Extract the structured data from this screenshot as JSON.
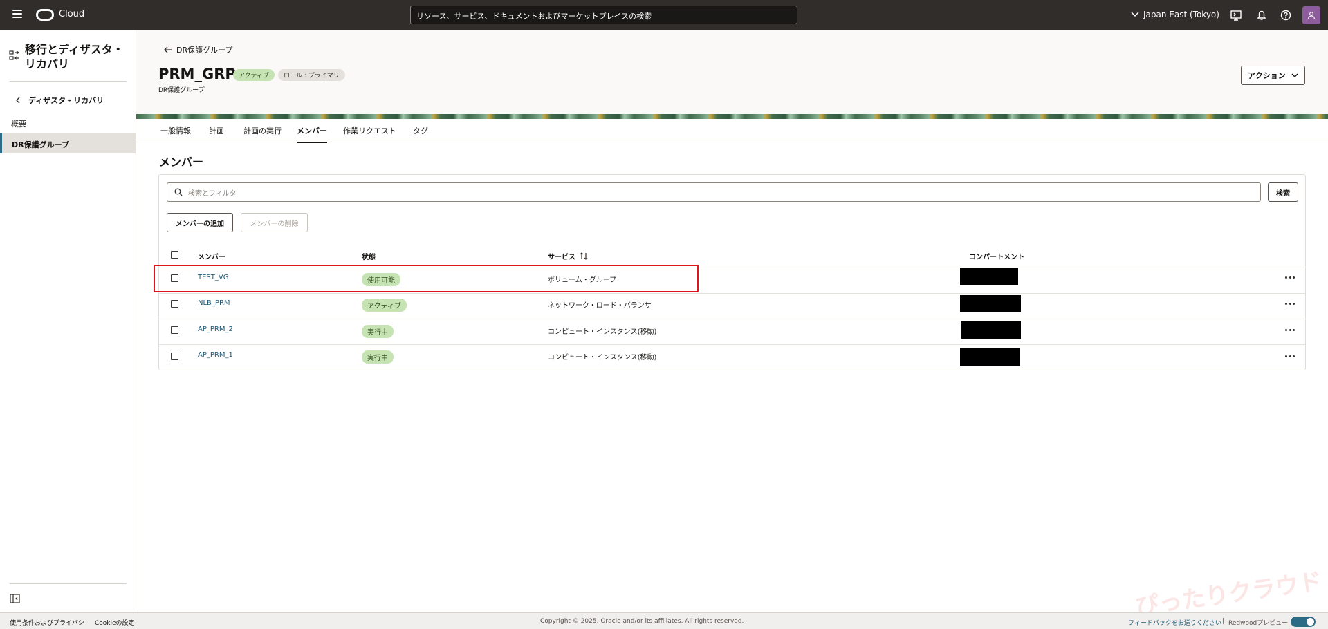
{
  "topbar": {
    "brand": "Cloud",
    "search_placeholder": "リソース、サービス、ドキュメントおよびマーケットプレイスの検索",
    "region": "Japan East (Tokyo)"
  },
  "sidenav": {
    "title": "移行とディザスタ・リカバリ",
    "back_label": "ディザスタ・リカバリ",
    "items": [
      {
        "label": "概要"
      },
      {
        "label": "DR保護グループ"
      }
    ]
  },
  "header": {
    "back_label": "DR保護グループ",
    "title": "PRM_GRP",
    "badge_status": "アクティブ",
    "badge_role": "ロール : プライマリ",
    "subtitle": "DR保護グループ",
    "actions_label": "アクション"
  },
  "tabs": [
    {
      "label": "一般情報"
    },
    {
      "label": "計画"
    },
    {
      "label": "計画の実行"
    },
    {
      "label": "メンバー"
    },
    {
      "label": "作業リクエスト"
    },
    {
      "label": "タグ"
    }
  ],
  "members": {
    "section_title": "メンバー",
    "filter_placeholder": "検索とフィルタ",
    "search_label": "検索",
    "add_label": "メンバーの追加",
    "delete_label": "メンバーの削除",
    "columns": {
      "member": "メンバー",
      "status": "状態",
      "service": "サービス",
      "compartment": "コンパートメント"
    },
    "rows": [
      {
        "name": "TEST_VG",
        "status": "使用可能",
        "service": "ボリューム・グループ"
      },
      {
        "name": "NLB_PRM",
        "status": "アクティブ",
        "service": "ネットワーク・ロード・バランサ"
      },
      {
        "name": "AP_PRM_2",
        "status": "実行中",
        "service": "コンピュート・インスタンス(移動)"
      },
      {
        "name": "AP_PRM_1",
        "status": "実行中",
        "service": "コンピュート・インスタンス(移動)"
      }
    ]
  },
  "footer": {
    "terms": "使用条件およびプライバシ",
    "cookie": "Cookieの設定",
    "copyright": "Copyright © 2025, Oracle and/or its affiliates. All rights reserved.",
    "feedback": "フィードバックをお送りください",
    "separator": "|",
    "redwood": "Redwoodプレビュー"
  },
  "watermark": "ぴったりクラウド",
  "colors": {
    "topbar": "#312d2a",
    "link": "#1d5a78",
    "active_badge": "#c6e3b3",
    "highlight": "#e0141e",
    "toggle": "#2b6b86"
  }
}
